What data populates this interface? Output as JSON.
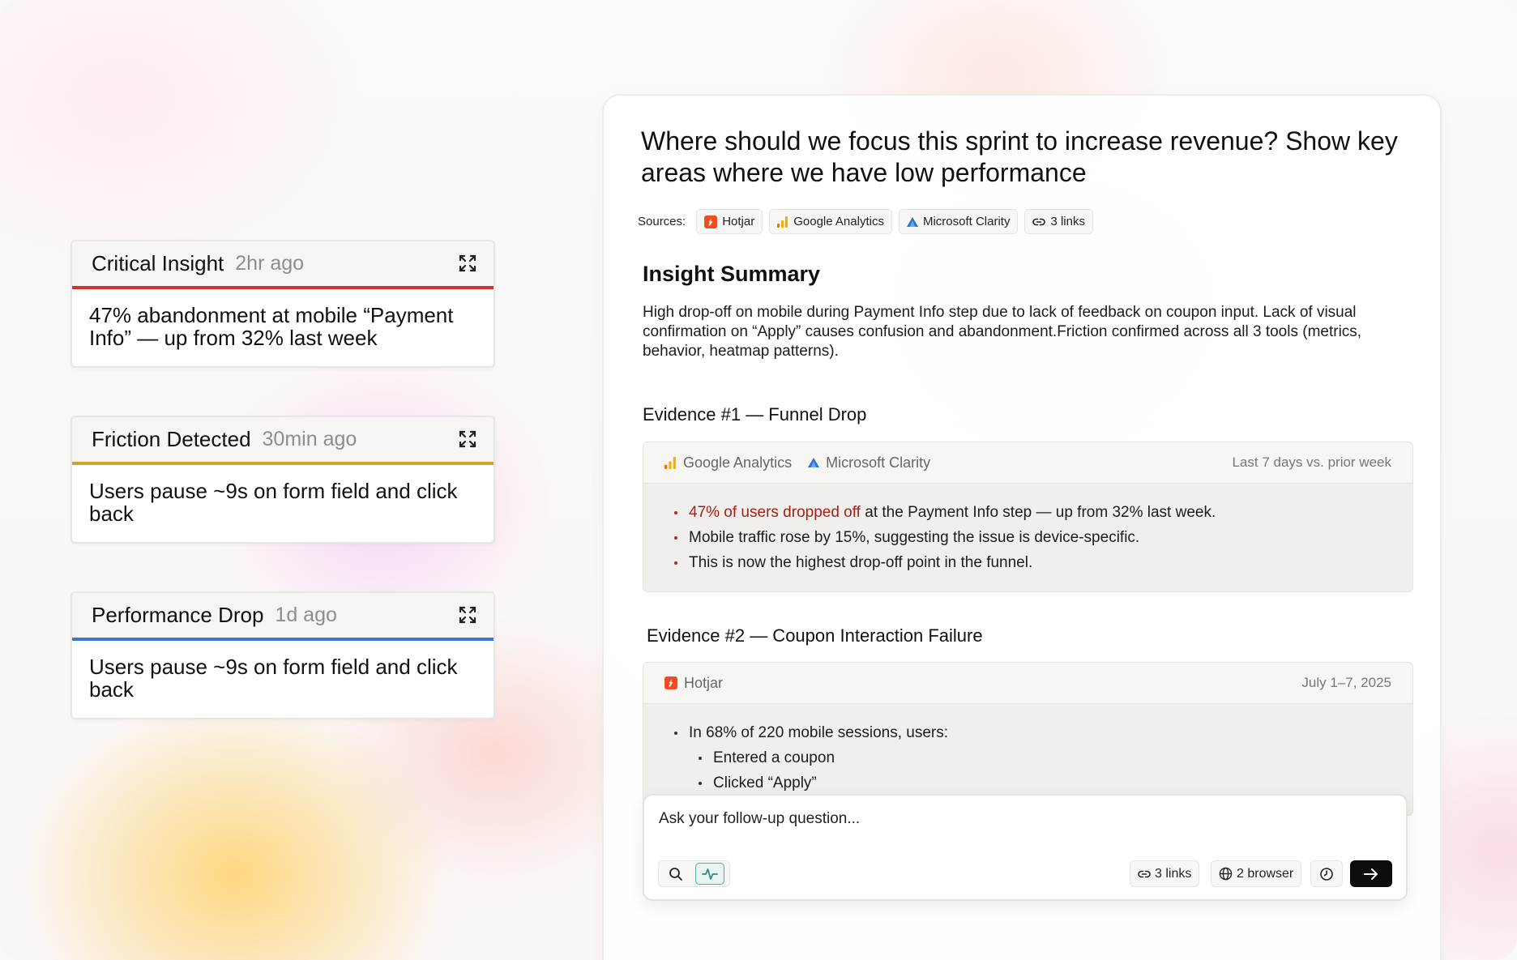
{
  "alerts": [
    {
      "title": "Critical Insight",
      "time": "2hr ago",
      "text": "47% abandonment at mobile “Payment Info” — up from 32% last week",
      "color": "#d62f2f"
    },
    {
      "title": "Friction Detected",
      "time": "30min ago",
      "text": "Users pause ~9s on form field and click back",
      "color": "#d6a12a"
    },
    {
      "title": "Performance Drop",
      "time": "1d ago",
      "text": "Users pause ~9s on form field and click back",
      "color": "#3e77c6"
    }
  ],
  "main": {
    "question": "Where should we focus this sprint to increase revenue? Show key areas where we have low performance",
    "sources_label": "Sources:",
    "sources": [
      {
        "icon": "hotjar-icon",
        "label": "Hotjar"
      },
      {
        "icon": "google-analytics-icon",
        "label": "Google Analytics"
      },
      {
        "icon": "microsoft-clarity-icon",
        "label": "Microsoft Clarity"
      },
      {
        "icon": "link-icon",
        "label": "3 links"
      }
    ],
    "summary_title": "Insight Summary",
    "summary_text": "High drop-off on mobile during Payment Info step due to lack of feedback on coupon input. Lack of visual confirmation on “Apply” causes confusion and abandonment.Friction confirmed across all 3 tools (metrics, behavior, heatmap patterns).",
    "evidence1": {
      "title": "Evidence #1 — Funnel Drop",
      "source1": "Google Analytics",
      "source2": "Microsoft Clarity",
      "period": "Last 7 days vs. prior week",
      "b1_highlight": "47% of users dropped off",
      "b1_rest": " at the Payment Info step — up from 32% last week.",
      "b2": "Mobile traffic rose by 15%, suggesting the issue is device-specific.",
      "b3": "This is now the highest drop-off point in the funnel."
    },
    "evidence2": {
      "title": "Evidence #2 — Coupon Interaction Failure",
      "source": "Hotjar",
      "period": "July 1–7, 2025",
      "b1": "In 68% of 220 mobile sessions, users:",
      "sub1": "Entered a coupon",
      "sub2": "Clicked “Apply”"
    },
    "input": {
      "placeholder": "Ask your follow-up question...",
      "links": "3 links",
      "browser": "2 browser"
    }
  },
  "colors": {
    "hotjar": "#f04b23",
    "accent_red": "#a4211c",
    "teal": "#2f8c7c"
  }
}
